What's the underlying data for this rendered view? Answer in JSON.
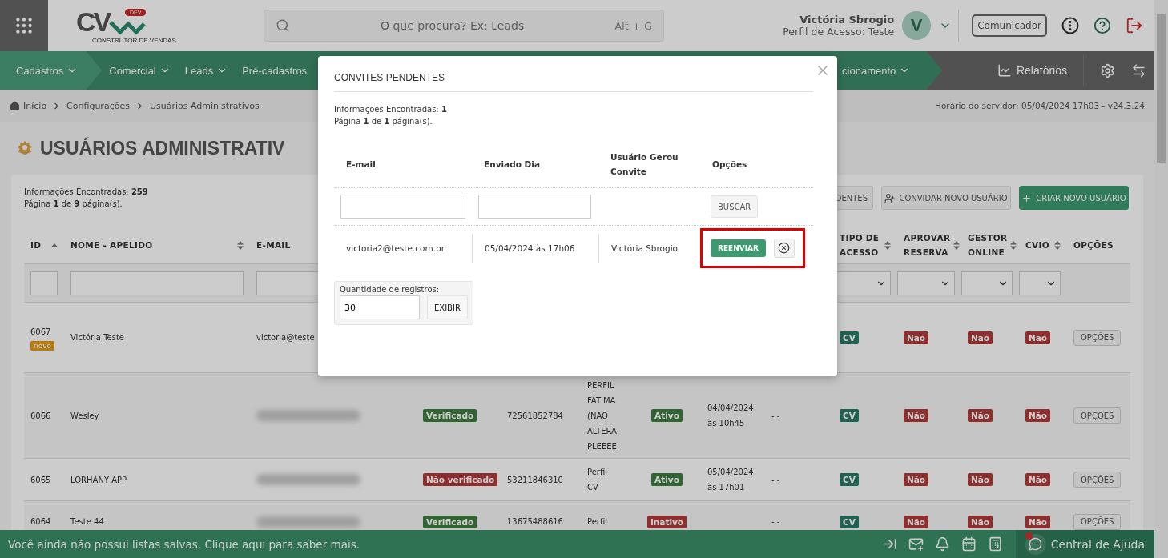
{
  "topbar": {
    "logo": {
      "mark": "CV",
      "badge": "DEV",
      "tagline": "CONSTRUTOR DE VENDAS"
    },
    "search": {
      "placeholder": "O que procura? Ex: Leads",
      "shortcut": "Alt + G"
    },
    "user": {
      "name": "Victória Sbrogio",
      "profile": "Perfil de Acesso: Teste",
      "initial": "V"
    },
    "communicator": "Comunicador"
  },
  "nav": {
    "items": [
      {
        "label": "Cadastros",
        "selected": true
      },
      {
        "label": "Comercial",
        "selected": false
      },
      {
        "label": "Leads",
        "selected": false
      },
      {
        "label": "Pré-cadastros",
        "selected": false
      }
    ],
    "trailing_item": "cionamento",
    "reports": "Relatórios"
  },
  "breadcrumb": {
    "items": [
      "Início",
      "Configurações",
      "Usuários Administrativos"
    ],
    "server_time": "Horário do servidor: 05/04/2024 17h03 - v24.3.24"
  },
  "page": {
    "title": "USUÁRIOS ADMINISTRATIV",
    "found": "Informações Encontradas: **259**",
    "pages": "Página **1** de **9** página(s).",
    "actions": [
      {
        "label": "DENTES",
        "kind": "plain"
      },
      {
        "label": "CONVIDAR NOVO USUÁRIO",
        "kind": "invite"
      },
      {
        "label": "CRIAR NOVO USUÁRIO",
        "kind": "primary"
      }
    ]
  },
  "table": {
    "columns": {
      "id": {
        "label": "ID",
        "sortable": true,
        "sorted": true
      },
      "name": {
        "label": "NOME - APELIDO",
        "sortable": true,
        "sorted": false
      },
      "email": {
        "label": "E-MAIL"
      },
      "access_type": {
        "label": "TIPO DE ACESSO",
        "sortable": true,
        "sorted": false
      },
      "approve_booking": {
        "label": "APROVAR RESERVA",
        "sortable": true,
        "sorted": false
      },
      "online_manager": {
        "label": "GESTOR ONLINE",
        "sortable": true,
        "sorted": false
      },
      "cvio": {
        "label": "CVIO",
        "sortable": true,
        "sorted": false
      },
      "options": {
        "label": "OPÇÕES"
      }
    },
    "rows": [
      {
        "id": "6067",
        "tag": "novo",
        "name": "Victória Teste",
        "email": "victoria@teste",
        "access_type": "CV",
        "approve_booking": "Não",
        "online_manager": "Não",
        "cvio": "Não",
        "options": "OPÇÕES"
      },
      {
        "id": "6066",
        "name": "Wesley",
        "email_blurred": true,
        "verification": {
          "label": "Verificado",
          "verified": true
        },
        "phone": "72561852784",
        "profile": "PERFIL FÁTIMA (NÃO ALTERA PLEEEE",
        "status": {
          "label": "Ativo",
          "active": true
        },
        "last_access": "04/04/2024 às 10h45",
        "column_9": "- -",
        "access_type": "CV",
        "approve_booking": "Não",
        "online_manager": "Não",
        "cvio": "Não",
        "options": "OPÇÕES"
      },
      {
        "id": "6065",
        "name": "LORHANY APP",
        "email_blurred": true,
        "verification": {
          "label": "Não verificado",
          "verified": false
        },
        "phone": "53211846310",
        "profile": "Perfil CV",
        "status": {
          "label": "Ativo",
          "active": true
        },
        "last_access": "05/04/2024 às 17h01",
        "column_9": "- -",
        "access_type": "CV",
        "approve_booking": "Não",
        "online_manager": "Não",
        "cvio": "Não",
        "options": "OPÇÕES"
      },
      {
        "id": "6064",
        "name": "Teste 44",
        "email_blurred": true,
        "verification": {
          "label": "Verificado",
          "verified": true
        },
        "phone": "13675488616",
        "profile": "Perfil",
        "status": {
          "label": "Inativo",
          "active": false
        },
        "column_9": "- -",
        "access_type": "CV",
        "approve_booking": "Não",
        "online_manager": "Não",
        "cvio": "Não",
        "options": "OPÇÕES"
      }
    ]
  },
  "modal": {
    "title": "CONVITES PENDENTES",
    "found": "Informações Encontradas: **1**",
    "pages": "Página **1** de **1** página(s).",
    "columns": [
      "E-mail",
      "Enviado Dia",
      "Usuário Gerou Convite",
      "Opções"
    ],
    "search_button": "BUSCAR",
    "rows": [
      {
        "email": "victoria2@teste.com.br",
        "sent": "05/04/2024 às 17h06",
        "user": "Victória Sbrogio",
        "resend": "REENVIAR",
        "highlighted": true
      }
    ],
    "page_size": {
      "label": "Quantidade de registros:",
      "value": "30",
      "button": "EXIBIR"
    }
  },
  "footer": {
    "message": "Você ainda não possui listas salvas. Clique aqui para saber mais.",
    "help": "Central de Ajuda",
    "has_notification": true
  }
}
